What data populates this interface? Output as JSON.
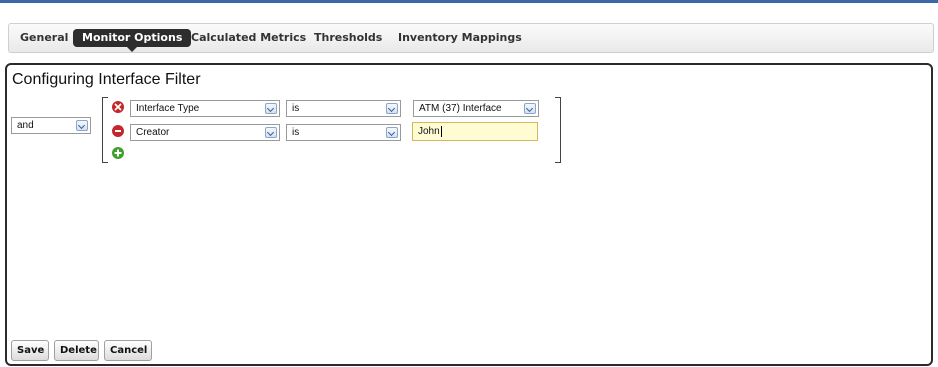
{
  "tabs": [
    {
      "label": "General"
    },
    {
      "label": "Monitor Options"
    },
    {
      "label": "Calculated Metrics"
    },
    {
      "label": "Thresholds"
    },
    {
      "label": "Inventory Mappings"
    }
  ],
  "active_tab": "Monitor Options",
  "panel": {
    "title": "Configuring Interface Filter",
    "logic_operator": "and",
    "conditions": [
      {
        "field": "Interface Type",
        "operator": "is",
        "value": "ATM (37) Interface",
        "value_kind": "select",
        "icon": "remove-icon-red-x"
      },
      {
        "field": "Creator",
        "operator": "is",
        "value": "John",
        "value_kind": "text",
        "icon": "minus-icon-red"
      }
    ],
    "add_icon": "add-icon-green-plus"
  },
  "buttons": {
    "save": "Save",
    "delete": "Delete",
    "cancel": "Cancel"
  },
  "colors": {
    "accent_bar": "#3b69a7",
    "active_tab": "#2d2d2d",
    "input_highlight": "#fffbd3"
  }
}
